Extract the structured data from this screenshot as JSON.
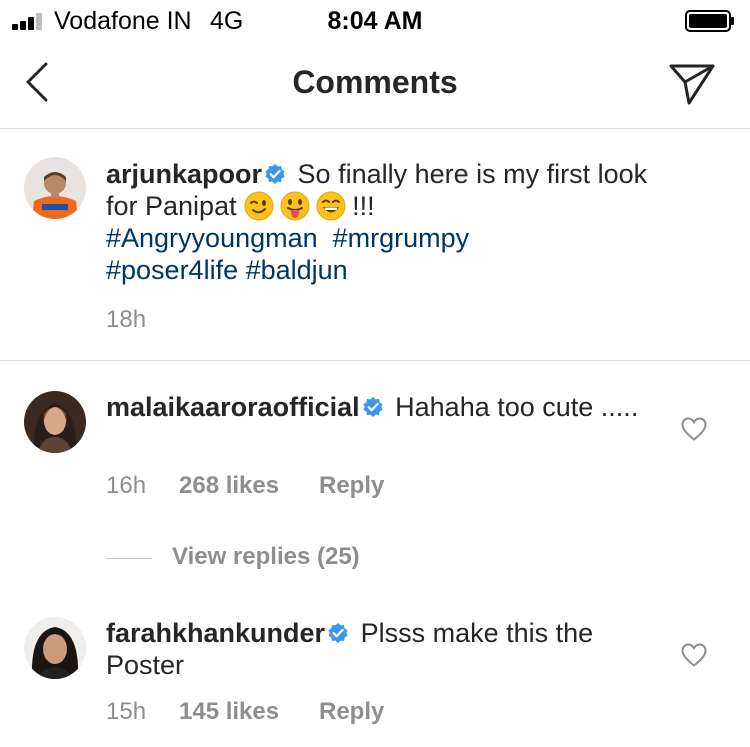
{
  "status_bar": {
    "carrier": "Vodafone IN",
    "network": "4G",
    "time": "8:04 AM"
  },
  "nav": {
    "title": "Comments",
    "back_icon": "chevron-left-icon",
    "send_icon": "paper-plane-icon"
  },
  "caption": {
    "username": "arjunkapoor",
    "verified": true,
    "text_before_emoji": "So finally here is my first look for Panipat",
    "emojis": [
      "winking-face-emoji",
      "tongue-face-emoji",
      "grinning-face-emoji"
    ],
    "text_after_emoji": "!!!",
    "hashtags": [
      "#Angryyoungman",
      "#mrgrumpy",
      "#poser4life",
      "#baldjun"
    ],
    "time": "18h"
  },
  "comments": [
    {
      "username": "malaikaaroraofficial",
      "verified": true,
      "text": "Hahaha too cute .....",
      "time": "16h",
      "likes": "268 likes",
      "reply_label": "Reply",
      "view_replies": "View replies (25)"
    },
    {
      "username": "farahkhankunder",
      "verified": true,
      "text": "Plsss make this the Poster",
      "time": "15h",
      "likes": "145 likes",
      "reply_label": "Reply"
    }
  ],
  "colors": {
    "hashtag": "#003569",
    "verified_badge": "#3897f0",
    "meta_text": "#8e8e8e",
    "divider": "#dbdbdb"
  }
}
